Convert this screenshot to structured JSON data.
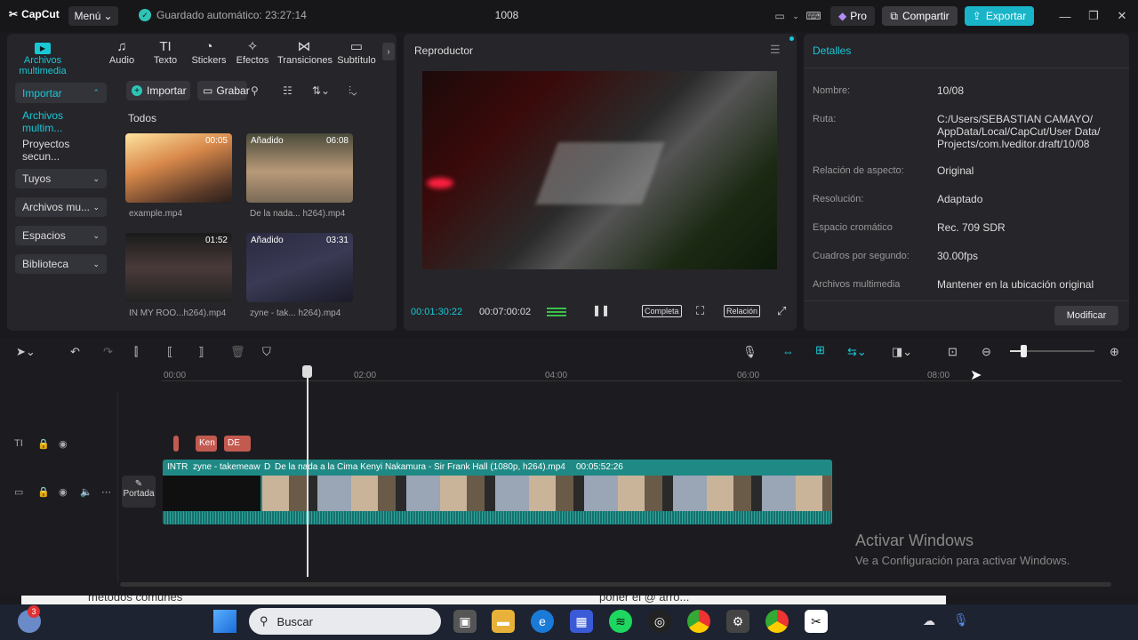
{
  "app": {
    "name": "CapCut",
    "menu_label": "Menú",
    "autosave": "Guardado automático: 23:27:14",
    "project_title": "1008"
  },
  "header": {
    "pro_label": "Pro",
    "share_label": "Compartir",
    "export_label": "Exportar"
  },
  "media_tabs": [
    {
      "label": "Archivos multimedia",
      "icon": "play-box-icon"
    },
    {
      "label": "Audio",
      "icon": "audio-icon"
    },
    {
      "label": "Texto",
      "icon": "text-icon"
    },
    {
      "label": "Stickers",
      "icon": "sticker-icon"
    },
    {
      "label": "Efectos",
      "icon": "effects-icon"
    },
    {
      "label": "Transiciones",
      "icon": "transition-icon"
    },
    {
      "label": "Subtítulo",
      "icon": "subtitle-icon"
    }
  ],
  "sidebar": {
    "import_label": "Importar",
    "items": [
      {
        "label": "Archivos multim..."
      },
      {
        "label": "Proyectos secun..."
      },
      {
        "label": "Tuyos"
      },
      {
        "label": "Archivos mu..."
      },
      {
        "label": "Espacios"
      },
      {
        "label": "Biblioteca"
      }
    ]
  },
  "media_toolbar": {
    "import_label": "Importar",
    "record_label": "Grabar",
    "all_label": "Todos"
  },
  "media_items": [
    {
      "name": "example.mp4",
      "duration": "00:05",
      "badge": ""
    },
    {
      "name": "De la nada... h264).mp4",
      "duration": "06:08",
      "badge": "Añadido"
    },
    {
      "name": "IN MY ROO...h264).mp4",
      "duration": "01:52",
      "badge": ""
    },
    {
      "name": "zyne - tak... h264).mp4",
      "duration": "03:31",
      "badge": "Añadido"
    }
  ],
  "player": {
    "title": "Reproductor",
    "current_time": "00:01:30:22",
    "total_time": "00:07:00:02",
    "full_label": "Completa",
    "ratio_label": "Relación"
  },
  "details": {
    "title": "Detalles",
    "rows": [
      {
        "key": "Nombre:",
        "value": "10/08"
      },
      {
        "key": "Ruta:",
        "value": "C:/Users/SEBASTIAN CAMAYO/ AppData/Local/CapCut/User Data/ Projects/com.lveditor.draft/10/08"
      },
      {
        "key": "Relación de aspecto:",
        "value": "Original"
      },
      {
        "key": "Resolución:",
        "value": "Adaptado"
      },
      {
        "key": "Espacio cromático",
        "value": "Rec. 709 SDR"
      },
      {
        "key": "Cuadros por segundo:",
        "value": "30.00fps"
      },
      {
        "key": "Archivos multimedia",
        "value": "Mantener en la ubicación original"
      }
    ],
    "modify_label": "Modificar"
  },
  "timeline": {
    "ruler": [
      "00:00",
      "02:00",
      "04:00",
      "06:00",
      "08:00"
    ],
    "text_clips": [
      "Ken",
      "DE LA"
    ],
    "main_clip_intro": "INTR",
    "main_clip_zyne": "zyne - takemeaw",
    "main_clip_d": "D",
    "main_clip_title": "De la nada a la Cima Kenyi Nakamura - Sir Frank Hall (1080p, h264).mp4",
    "main_clip_duration": "00:05:52:26",
    "cover_label": "Portada"
  },
  "watermark": {
    "title": "Activar Windows",
    "subtitle": "Ve a Configuración para activar Windows."
  },
  "taskbar": {
    "search_placeholder": "Buscar",
    "badge_count": "3",
    "browser_text_left": "métodos comunes",
    "browser_text_mid": "poner el @ arro..."
  },
  "colors": {
    "accent": "#19c8d6",
    "export": "#19b4c8",
    "track": "#1f8a85",
    "text_clip": "#c25a50"
  }
}
